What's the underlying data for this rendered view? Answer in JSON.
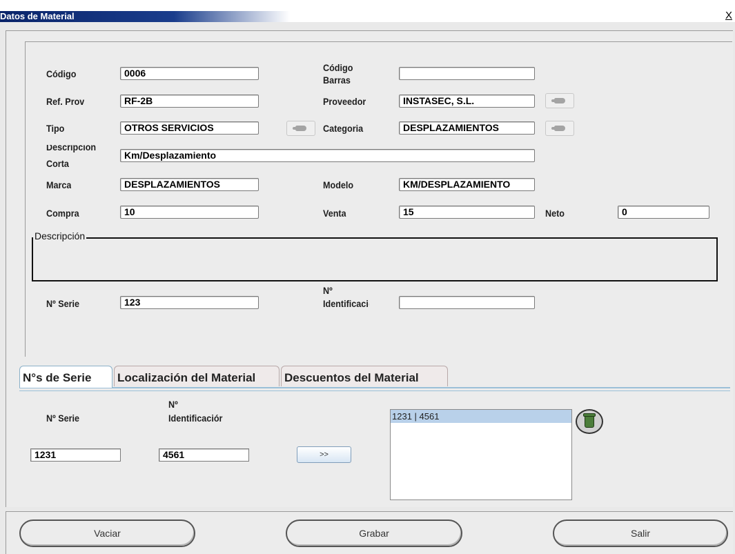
{
  "window": {
    "title": "Datos de Material",
    "close_glyph": "X"
  },
  "fields": {
    "codigo": {
      "label": "Código",
      "value": "0006"
    },
    "codigo_barras": {
      "label_line1": "Código",
      "label_line2": "Barras",
      "value": ""
    },
    "ref_prov": {
      "label": "Ref. Prov",
      "value": "RF-2B"
    },
    "proveedor": {
      "label": "Proveedor",
      "value": "INSTASEC, S.L."
    },
    "tipo": {
      "label": "Tipo",
      "value": "OTROS SERVICIOS"
    },
    "categoria": {
      "label": "Categoria",
      "value": "DESPLAZAMIENTOS"
    },
    "descripcion_corta": {
      "label_line1": "Descripcion",
      "label_line2": "Corta",
      "value": "Km/Desplazamiento"
    },
    "marca": {
      "label": "Marca",
      "value": "DESPLAZAMIENTOS"
    },
    "modelo": {
      "label": "Modelo",
      "value": "KM/DESPLAZAMIENTO"
    },
    "compra": {
      "label": "Compra",
      "value": "10"
    },
    "venta": {
      "label": "Venta",
      "value": "15"
    },
    "neto": {
      "label": "Neto",
      "value": "0"
    },
    "descripcion": {
      "legend": "Descripción",
      "value": ""
    },
    "n_serie": {
      "label": "Nº Serie",
      "value": "123"
    },
    "n_identificacion": {
      "label_line1": "Nº",
      "label_line2": "Identificaciór",
      "value": ""
    }
  },
  "tabs": [
    {
      "label": "N°s de Serie",
      "active": true
    },
    {
      "label": "Localización del Material",
      "active": false
    },
    {
      "label": "Descuentos del Material",
      "active": false
    }
  ],
  "serie_tab": {
    "serie_label": "Nº Serie",
    "ident_label_line1": "Nº",
    "ident_label_line2": "Identificaciór",
    "serie_value": "1231",
    "ident_value": "4561",
    "add_button": ">>",
    "list_items": [
      "1231 | 4561"
    ]
  },
  "buttons": {
    "vaciar": "Vaciar",
    "grabar": "Grabar",
    "salir": "Salir"
  },
  "icons": {
    "lookup": "pointing-hand-icon",
    "delete": "trash-icon"
  },
  "colors": {
    "title_bar": "#0a246a",
    "tab_accent": "#9bbfd8",
    "list_selection": "#b9d1ea"
  }
}
